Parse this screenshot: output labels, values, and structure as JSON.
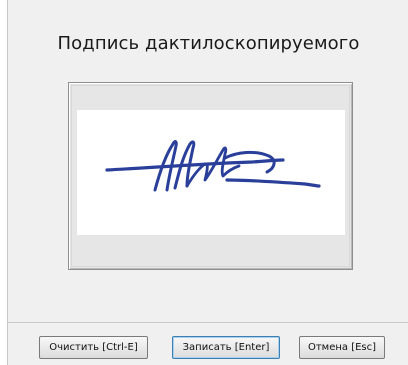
{
  "dialog": {
    "title": "Подпись дактилоскопируемого"
  },
  "signature": {
    "stroke_color": "#2a3f9a"
  },
  "buttons": {
    "clear_label": "Очистить [Ctrl-E]",
    "save_label": "Записать [Enter]",
    "cancel_label": "Отмена [Esc]"
  }
}
